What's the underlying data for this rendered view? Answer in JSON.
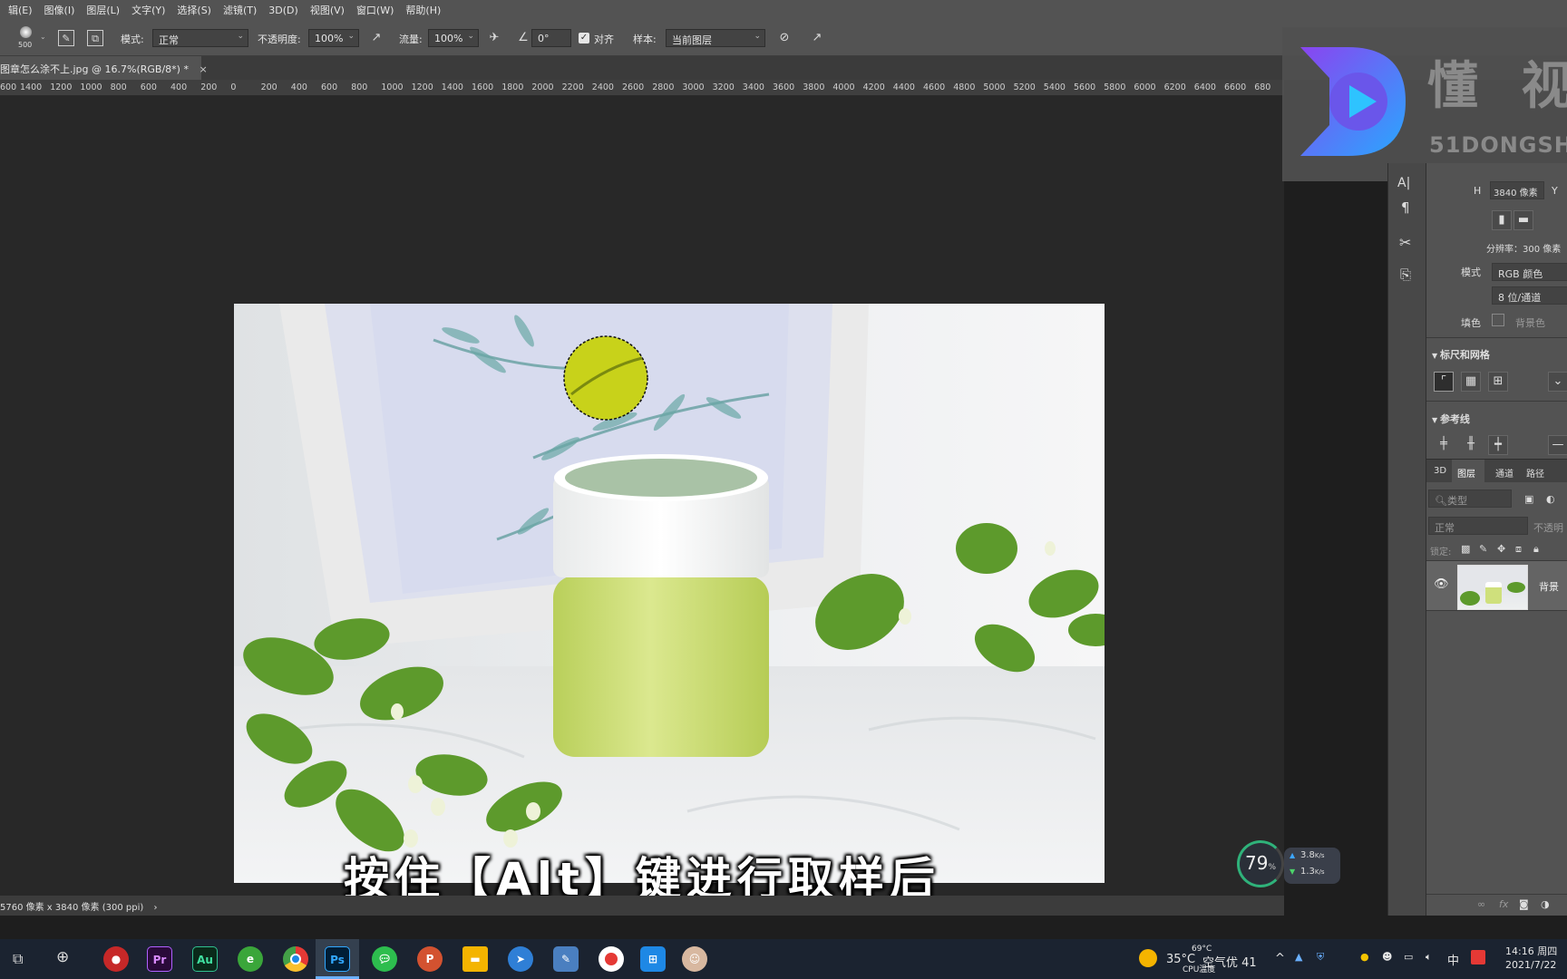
{
  "menubar": [
    "辑(E)",
    "图像(I)",
    "图层(L)",
    "文字(Y)",
    "选择(S)",
    "滤镜(T)",
    "3D(D)",
    "视图(V)",
    "窗口(W)",
    "帮助(H)"
  ],
  "options": {
    "brush_size": "500",
    "mode_label": "模式:",
    "mode_value": "正常",
    "opacity_label": "不透明度:",
    "opacity_value": "100%",
    "flow_label": "流量:",
    "flow_value": "100%",
    "angle_value": "0°",
    "aligned_label": "对齐",
    "sample_label": "样本:",
    "sample_value": "当前图层"
  },
  "document_tab": {
    "title": "图章怎么涂不上.jpg @ 16.7%(RGB/8*) *",
    "close": "×"
  },
  "ruler_ticks": [
    "600",
    "1400",
    "1200",
    "1000",
    "800",
    "600",
    "400",
    "200",
    "0",
    "200",
    "400",
    "600",
    "800",
    "1000",
    "1200",
    "1400",
    "1600",
    "1800",
    "2000",
    "2200",
    "2400",
    "2600",
    "2800",
    "3000",
    "3200",
    "3400",
    "3600",
    "3800",
    "4000",
    "4200",
    "4400",
    "4600",
    "4800",
    "5000",
    "5200",
    "5400",
    "5600",
    "5800",
    "6000",
    "6200",
    "6400",
    "6600",
    "680"
  ],
  "status_bar": {
    "info": "5760 像素 x 3840 像素 (300 ppi)",
    "arrow": "›"
  },
  "subtitle": "按住【Alt】键进行取样后",
  "watermark": {
    "brand": "懂 视",
    "url": "51DONGSHI.C"
  },
  "properties_panel": {
    "h_label": "H",
    "h_value": "3840 像素",
    "y_label": "Y",
    "resolution": "分辨率：300 像素",
    "mode_label": "模式",
    "mode_value": "RGB 颜色",
    "depth_value": "8 位/通道",
    "fill_label": "填色",
    "fill_value": "背景色",
    "rulers_grids": "标尺和网格",
    "guides": "参考线"
  },
  "layers_panel": {
    "tabs": [
      "3D",
      "图层",
      "通道",
      "路径"
    ],
    "active_tab": 1,
    "filter_placeholder": "类型",
    "blend_mode": "正常",
    "opacity_label": "不透明",
    "lock_label": "锁定:",
    "layer_name": "背景"
  },
  "perf_widget": {
    "cpu_percent": "79",
    "percent_sign": "%",
    "upload": "3.8",
    "download": "1.3",
    "unit": "K/s"
  },
  "taskbar": {
    "apps": [
      "Pr",
      "Au",
      "Ps",
      "P"
    ],
    "weather_temp": "35°C",
    "weather_text": "空气优 41",
    "cpu_temp": "69°C",
    "cpu_label": "CPU温度",
    "ime": "中",
    "time": "14:16 周四",
    "date": "2021/7/22"
  },
  "colors": {
    "ps_panel": "#535353",
    "ps_canvas": "#282828",
    "taskbar": "#1b2330",
    "accent_blue": "#2f7fd6"
  }
}
